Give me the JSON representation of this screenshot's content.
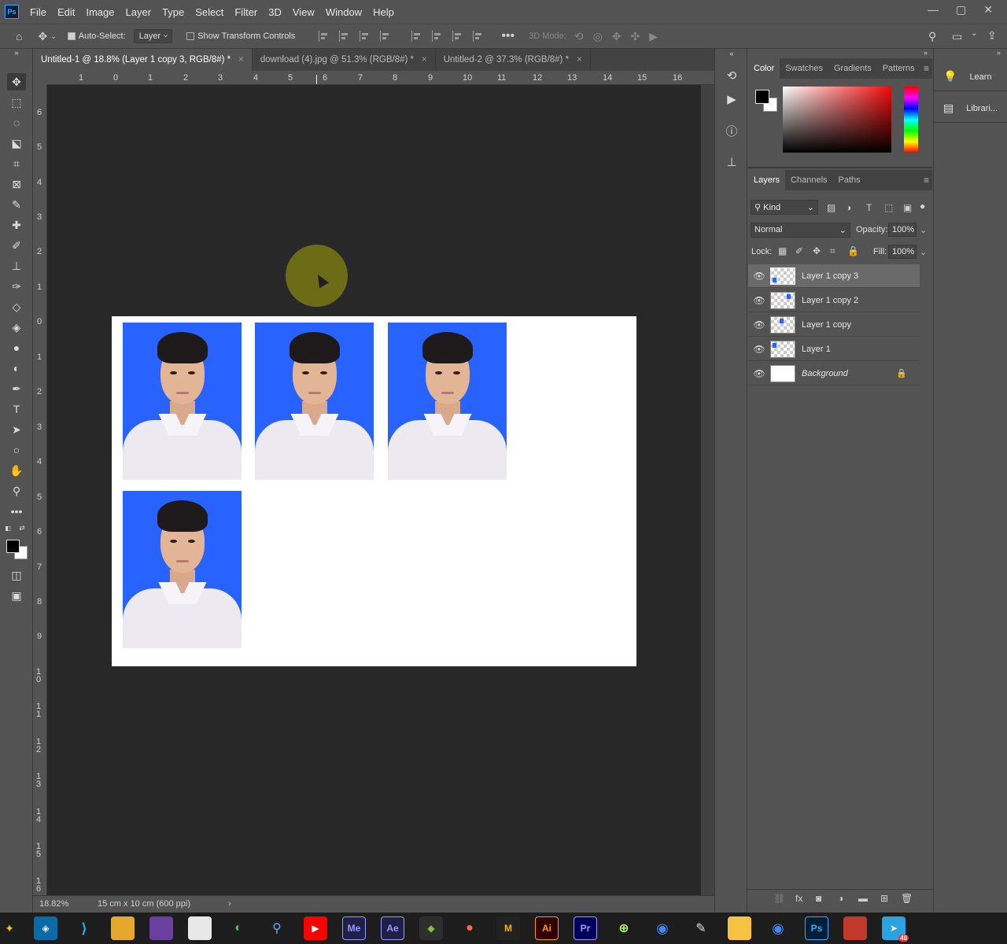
{
  "menu": [
    "File",
    "Edit",
    "Image",
    "Layer",
    "Type",
    "Select",
    "Filter",
    "3D",
    "View",
    "Window",
    "Help"
  ],
  "logo": "Ps",
  "window_controls": [
    "—",
    "▢",
    "✕"
  ],
  "options": {
    "auto_select_label": "Auto-Select:",
    "auto_select_value": "Layer",
    "transform_label": "Show Transform Controls",
    "mode_3d_label": "3D Mode:"
  },
  "tabs": [
    {
      "label": "Untitled-1 @ 18.8% (Layer 1 copy 3, RGB/8#) *",
      "active": true
    },
    {
      "label": "download (4).jpg @ 51.3% (RGB/8#) *",
      "active": false
    },
    {
      "label": "Untitled-2 @ 37.3% (RGB/8#) *",
      "active": false
    }
  ],
  "ruler_h": [
    "1",
    "0",
    "1",
    "2",
    "3",
    "4",
    "5",
    "6",
    "7",
    "8",
    "9",
    "10",
    "11",
    "12",
    "13",
    "14",
    "15",
    "16"
  ],
  "ruler_v": [
    "6",
    "5",
    "4",
    "3",
    "2",
    "1",
    "0",
    "1",
    "2",
    "3",
    "4",
    "5",
    "6",
    "7",
    "8",
    "9",
    "1 0",
    "1 1",
    "1 2",
    "1 3",
    "1 4",
    "1 5",
    "1 6"
  ],
  "status": {
    "zoom": "18.82%",
    "doc_info": "15 cm x 10 cm (600 ppi)"
  },
  "color_panel": {
    "tabs": [
      "Color",
      "Swatches",
      "Gradients",
      "Patterns"
    ],
    "fg": "#000000",
    "bg": "#ffffff"
  },
  "layers_panel": {
    "tabs": [
      "Layers",
      "Channels",
      "Paths"
    ],
    "filter_kind": "Kind",
    "blend_mode": "Normal",
    "opacity_label": "Opacity:",
    "opacity_value": "100%",
    "lock_label": "Lock:",
    "fill_label": "Fill:",
    "fill_value": "100%",
    "layers": [
      {
        "name": "Layer 1 copy 3",
        "selected": true
      },
      {
        "name": "Layer 1 copy 2",
        "selected": false
      },
      {
        "name": "Layer 1 copy",
        "selected": false
      },
      {
        "name": "Layer 1",
        "selected": false
      },
      {
        "name": "Background",
        "selected": false,
        "locked": true
      }
    ]
  },
  "learn_panel": {
    "learn": "Learn",
    "libraries": "Librari..."
  },
  "taskbar_apps": [
    "Me",
    "Ae",
    "Ai",
    "Pr",
    "Ps"
  ],
  "taskbar_badge": "48"
}
